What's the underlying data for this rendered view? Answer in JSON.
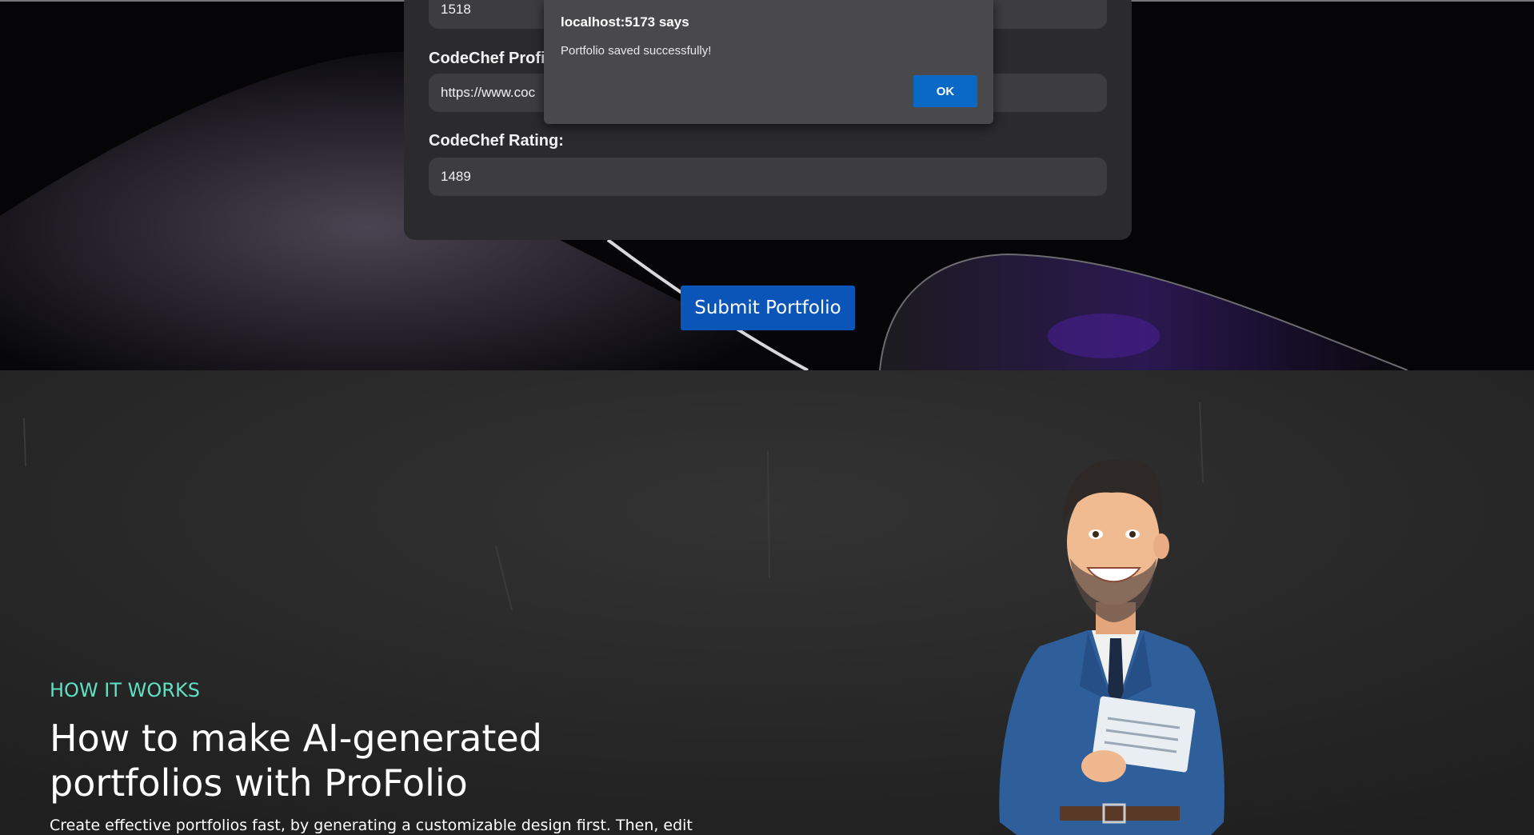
{
  "form": {
    "prev_value": "1518",
    "codechef_profile_label": "CodeChef Profi",
    "codechef_profile_value": "https://www.coc",
    "codechef_rating_label": "CodeChef Rating:",
    "codechef_rating_value": "1489",
    "submit_label": "Submit Portfolio"
  },
  "dialog": {
    "title": "localhost:5173 says",
    "message": "Portfolio saved successfully!",
    "ok_label": "OK"
  },
  "how_it_works": {
    "eyebrow": "HOW IT WORKS",
    "headline": "How to make AI-generated portfolios with ProFolio",
    "description": "Create effective portfolios fast, by generating a customizable design first. Then, edit"
  },
  "colors": {
    "accent_teal": "#5fe0c2",
    "button_blue": "#0b55b8",
    "dialog_ok_blue": "#0a69c6"
  }
}
